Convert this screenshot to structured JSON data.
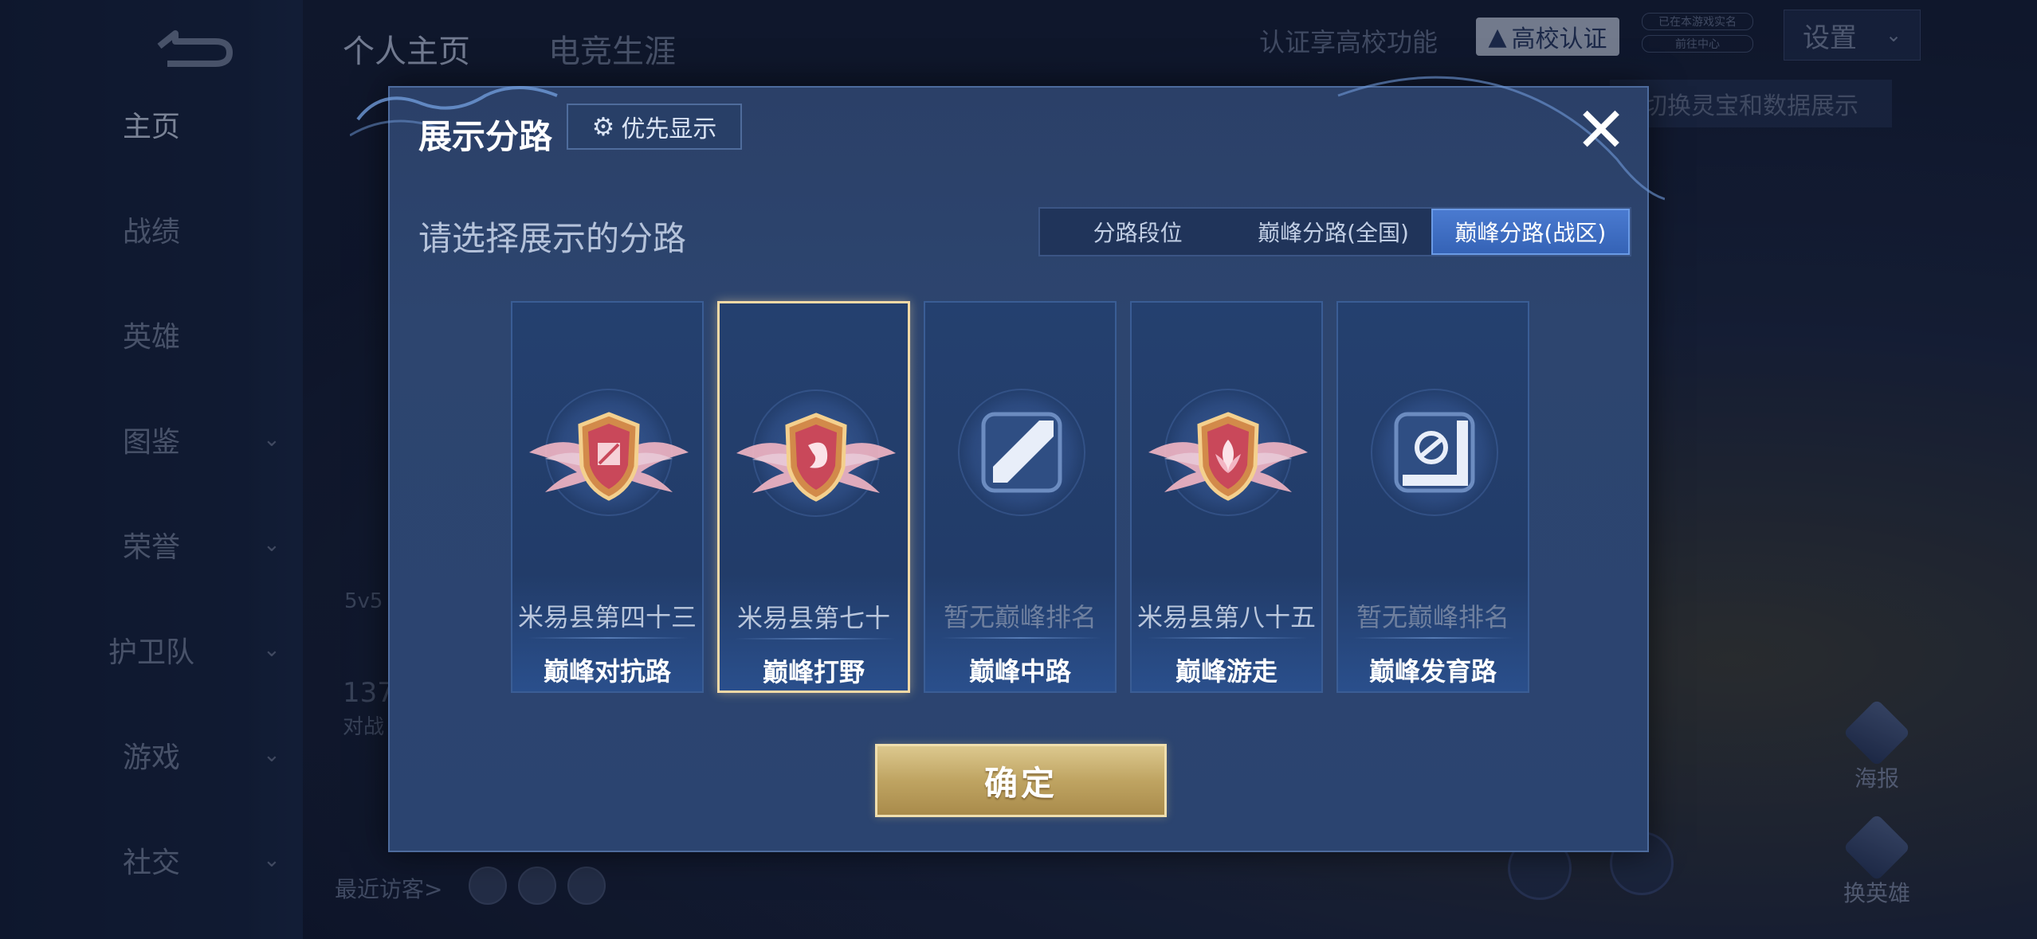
{
  "sidebar": {
    "items": [
      {
        "label": "主页",
        "active": true,
        "chevron": false
      },
      {
        "label": "战绩",
        "active": false,
        "chevron": false
      },
      {
        "label": "英雄",
        "active": false,
        "chevron": false
      },
      {
        "label": "图鉴",
        "active": false,
        "chevron": true
      },
      {
        "label": "荣誉",
        "active": false,
        "chevron": true
      },
      {
        "label": "护卫队",
        "active": false,
        "chevron": true
      },
      {
        "label": "游戏",
        "active": false,
        "chevron": true
      },
      {
        "label": "社交",
        "active": false,
        "chevron": true
      }
    ]
  },
  "header": {
    "tabs": [
      "个人主页",
      "电竞生涯"
    ],
    "auth_text": "认证享高校功能",
    "auth_badge": "高校认证",
    "mini_tags": [
      "已在本游戏实名",
      "前往中心"
    ],
    "settings_label": "设置",
    "switch_hint": "切换灵宝和数据展示"
  },
  "background": {
    "mode_text": "5v5",
    "count_text": "137",
    "count_label": "对战",
    "visitor_label": "最近访客>",
    "poster_label": "海报",
    "change_hero_label": "换英雄"
  },
  "modal": {
    "title": "展示分路",
    "priority_label": "优先显示",
    "close_glyph": "✕",
    "subtitle": "请选择展示的分路",
    "segments": [
      {
        "label": "分路段位",
        "active": false
      },
      {
        "label": "巅峰分路(全国)",
        "active": false
      },
      {
        "label": "巅峰分路(战区)",
        "active": true
      }
    ],
    "lanes": [
      {
        "rank": "米易县第四十三",
        "lane": "巅峰对抗路",
        "has_rank": true,
        "selected": false,
        "icon": "clash-lane-badge-icon"
      },
      {
        "rank": "米易县第七十",
        "lane": "巅峰打野",
        "has_rank": true,
        "selected": true,
        "icon": "jungle-badge-icon"
      },
      {
        "rank": "暂无巅峰排名",
        "lane": "巅峰中路",
        "has_rank": false,
        "selected": false,
        "icon": "mid-lane-icon"
      },
      {
        "rank": "米易县第八十五",
        "lane": "巅峰游走",
        "has_rank": true,
        "selected": false,
        "icon": "roam-badge-icon"
      },
      {
        "rank": "暂无巅峰排名",
        "lane": "巅峰发育路",
        "has_rank": false,
        "selected": false,
        "icon": "farm-lane-icon"
      }
    ],
    "confirm_label": "确定"
  },
  "colors": {
    "accent_blue": "#3563b6",
    "gold": "#bfa462",
    "selected_border": "#f4d9a6"
  }
}
